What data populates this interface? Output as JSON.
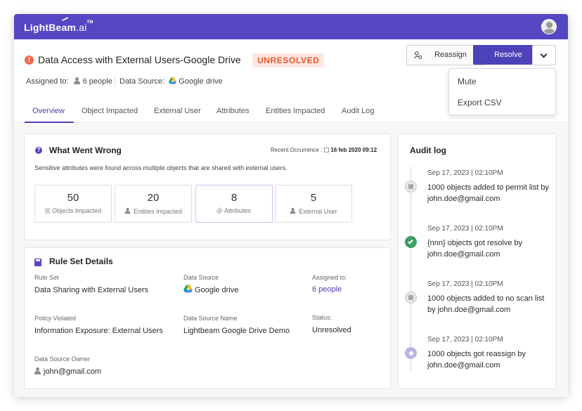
{
  "app": {
    "brand": "LightBeam",
    "brand_suffix": ".ai",
    "brand_tm": "TM"
  },
  "header": {
    "title": "Data Access with External Users-Google Drive",
    "status": "UNRESOLVED",
    "assigned_label": "Assigned to:",
    "assigned_value": "6 people",
    "source_label": "Data Source:",
    "source_value": "Google drive"
  },
  "actions": {
    "reassign": "Reassign",
    "resolve": "Resolve",
    "menu": [
      "Mute",
      "Export CSV"
    ]
  },
  "tabs": [
    "Overview",
    "Object Impacted",
    "External User",
    "Attributes",
    "Entities Impacted",
    "Audit Log"
  ],
  "what_went_wrong": {
    "title": "What Went Wrong",
    "recent_label": "Recent Occurrence :",
    "recent_value": "16 feb 2020 09:12",
    "description": "Sensitive attributes were found across multiple objects that are shared with external users.",
    "stats": [
      {
        "value": "50",
        "label": "Objects Impacted"
      },
      {
        "value": "20",
        "label": "Entities Impacted"
      },
      {
        "value": "8",
        "label": "Attributes"
      },
      {
        "value": "5",
        "label": "External User"
      }
    ]
  },
  "rule_set": {
    "title": "Rule Set Details",
    "rule_set_label": "Rule Set",
    "rule_set_value": "Data Sharing with External Users",
    "data_source_label": "Data Source",
    "data_source_value": "Google drive",
    "assigned_label": "Assigned to:",
    "assigned_value": "6 people",
    "policy_label": "Policy Violated",
    "policy_value": "Information Exposure: External Users",
    "ds_name_label": "Data Source Name",
    "ds_name_value": "Lightbeam Google Drive Demo",
    "status_label": "Status:",
    "status_value": "Unresolved",
    "owner_label": "Data Source Owner",
    "owner_value": "john@gmail.com"
  },
  "audit": {
    "title": "Audit log",
    "entries": [
      {
        "time": "Sep 17, 2023 | 02:10PM",
        "text": "1000 objects added to permit list by john.doe@gmail.com",
        "icon": "document-icon"
      },
      {
        "time": "Sep 17, 2023 | 02:10PM",
        "text": "{nnn} objects got resolve by john.doe@gmail.com",
        "icon": "check-icon"
      },
      {
        "time": "Sep 17, 2023 | 02:10PM",
        "text": "1000 objects added to no scan list by john.doe@gmail.com",
        "icon": "document-icon"
      },
      {
        "time": "Sep 17, 2023 | 02:10PM",
        "text": "1000 objects got reassign by john.doe@gmail.com",
        "icon": "reassign-icon"
      }
    ]
  },
  "colors": {
    "brand": "#5546c4",
    "status_text": "#e8582f",
    "status_bg": "#fde7df",
    "success": "#3d9e63"
  }
}
